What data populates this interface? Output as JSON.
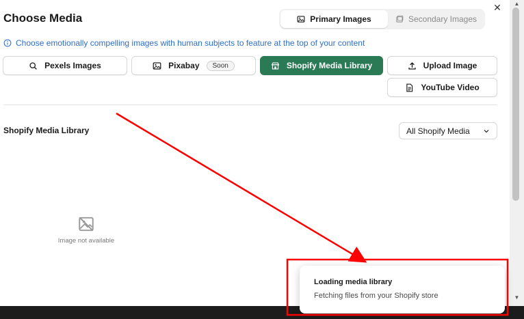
{
  "dialog": {
    "title": "Choose Media",
    "close_symbol": "✕"
  },
  "image_tabs": {
    "primary": "Primary Images",
    "secondary": "Secondary Images"
  },
  "info_text": "Choose emotionally compelling images with human subjects to feature at the top of your content",
  "sources": {
    "pexels": "Pexels Images",
    "pixabay": "Pixabay",
    "pixabay_badge": "Soon",
    "shopify": "Shopify Media Library",
    "upload": "Upload Image",
    "youtube": "YouTube Video"
  },
  "library": {
    "section_label": "Shopify Media Library",
    "filter_selected": "All Shopify Media",
    "placeholder_text": "Image not available"
  },
  "toast": {
    "title": "Loading media library",
    "subtitle": "Fetching files from your Shopify store"
  },
  "colors": {
    "accent_green": "#2a7a55",
    "info_blue": "#2c6ecb",
    "annotation_red": "#ff0000"
  },
  "icons": [
    "image-icon",
    "search-icon",
    "store-icon",
    "upload-icon",
    "file-icon",
    "info-icon",
    "chevron-down-icon",
    "image-off-icon",
    "close-icon"
  ]
}
